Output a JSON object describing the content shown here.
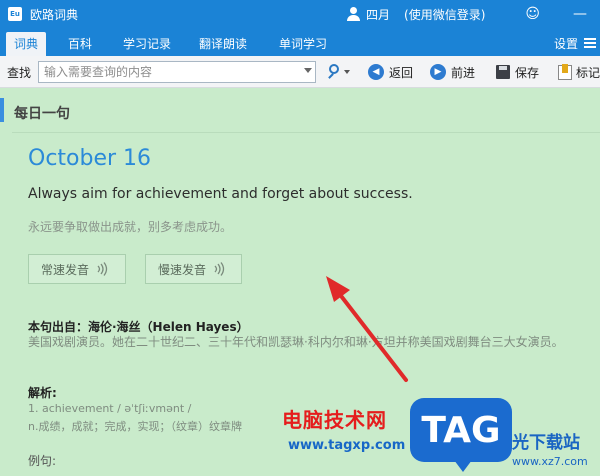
{
  "window": {
    "app_title": "欧路词典",
    "user_name": "四月",
    "login_hint": "(使用微信登录)",
    "minimize": "—",
    "smile": "☺"
  },
  "nav": {
    "tabs": [
      "词典",
      "百科",
      "学习记录",
      "翻译朗读",
      "单词学习"
    ],
    "active_tab": "词典",
    "settings": "设置"
  },
  "toolbar": {
    "search_label": "查找",
    "search_placeholder": "输入需要查询的内容",
    "back_label": "返回",
    "forward_label": "前进",
    "save_label": "保存",
    "mark_label": "标记"
  },
  "daily": {
    "section_title": "每日一句",
    "date": "October 16",
    "sentence_en": "Always aim for achievement and forget about success.",
    "sentence_cn": "永远要争取做出成就，别多考虑成功。",
    "normal_speed": "常速发音",
    "slow_speed": "慢速发音",
    "source_label": "本句出自：海伦·海丝（Helen Hayes）",
    "source_desc": "美国戏剧演员。她在二十世纪二、三十年代和凯瑟琳·科内尔和琳·方坦并称美国戏剧舞台三大女演员。",
    "analysis_label": "解析:",
    "analysis_word": "1. achievement / əˈtʃiːvmənt /",
    "analysis_def": "n.成绩，成就；完成，实现；（纹章）纹章牌",
    "example_label": "例句:"
  },
  "watermark": {
    "site_cn": "电脑技术网",
    "site_url": "www.tagxp.com",
    "tag": "TAG",
    "right_text": "光下载站",
    "right_url": "www.xz7.com"
  },
  "colors": {
    "titlebar": "#1b83d6",
    "content_bg": "#c9ebcb",
    "date_blue": "#2b8ad8",
    "arrow_red": "#e02a2a"
  }
}
